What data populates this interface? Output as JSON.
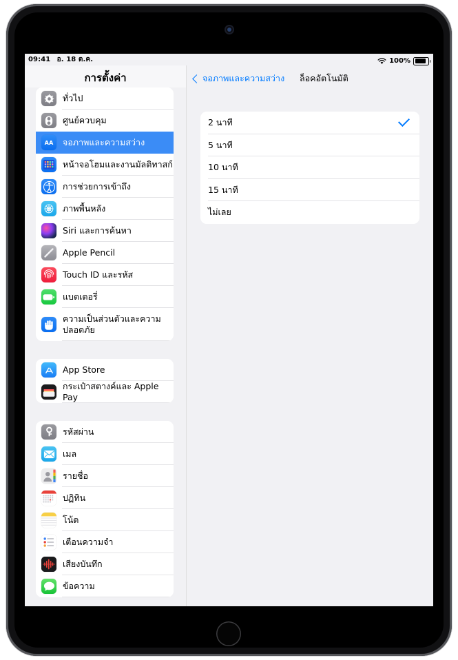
{
  "status_bar": {
    "time": "09:41",
    "date": "อ. 18 ต.ค.",
    "wifi_icon": "wifi-icon",
    "battery_percent": "100%",
    "battery_icon": "battery-full-icon"
  },
  "sidebar": {
    "title": "การตั้งค่า",
    "groups": [
      {
        "items": [
          {
            "label": "ทั่วไป",
            "icon": "gear-icon",
            "selected": false
          },
          {
            "label": "ศูนย์ควบคุม",
            "icon": "control-center-icon",
            "selected": false
          },
          {
            "label": "จอภาพและความสว่าง",
            "icon": "display-brightness-icon",
            "selected": true
          },
          {
            "label": "หน้าจอโฮมและงานมัลติทาสก์",
            "icon": "home-screen-multitasking-icon",
            "selected": false
          },
          {
            "label": "การช่วยการเข้าถึง",
            "icon": "accessibility-icon",
            "selected": false
          },
          {
            "label": "ภาพพื้นหลัง",
            "icon": "wallpaper-icon",
            "selected": false
          },
          {
            "label": "Siri และการค้นหา",
            "icon": "siri-icon",
            "selected": false
          },
          {
            "label": "Apple Pencil",
            "icon": "apple-pencil-icon",
            "selected": false
          },
          {
            "label": "Touch ID และรหัส",
            "icon": "touch-id-icon",
            "selected": false
          },
          {
            "label": "แบตเตอรี่",
            "icon": "battery-icon",
            "selected": false
          },
          {
            "label": "ความเป็นส่วนตัวและความปลอดภัย",
            "icon": "privacy-hand-icon",
            "selected": false
          }
        ]
      },
      {
        "items": [
          {
            "label": "App Store",
            "icon": "app-store-icon",
            "selected": false
          },
          {
            "label": "กระเป๋าสตางค์และ Apple Pay",
            "icon": "wallet-icon",
            "selected": false
          }
        ]
      },
      {
        "items": [
          {
            "label": "รหัสผ่าน",
            "icon": "passwords-key-icon",
            "selected": false
          },
          {
            "label": "เมล",
            "icon": "mail-icon",
            "selected": false
          },
          {
            "label": "รายชื่อ",
            "icon": "contacts-icon",
            "selected": false
          },
          {
            "label": "ปฏิทิน",
            "icon": "calendar-icon",
            "selected": false
          },
          {
            "label": "โน้ต",
            "icon": "notes-icon",
            "selected": false
          },
          {
            "label": "เตือนความจำ",
            "icon": "reminders-icon",
            "selected": false
          },
          {
            "label": "เสียงบันทึก",
            "icon": "voice-memos-icon",
            "selected": false
          },
          {
            "label": "ข้อความ",
            "icon": "messages-icon",
            "selected": false
          }
        ]
      }
    ]
  },
  "detail": {
    "back_label": "จอภาพและความสว่าง",
    "back_icon": "chevron-left-icon",
    "title": "ล็อคอัตโนมัติ",
    "options": [
      {
        "label": "2 นาที",
        "checked": true
      },
      {
        "label": "5 นาที",
        "checked": false
      },
      {
        "label": "10 นาที",
        "checked": false
      },
      {
        "label": "15 นาที",
        "checked": false
      },
      {
        "label": "ไม่เลย",
        "checked": false
      }
    ],
    "checkmark_icon": "checkmark-icon"
  },
  "colors": {
    "accent": "#007aff",
    "selected_row": "#3b8cf6",
    "screen_bg": "#f1f1f4",
    "card_bg": "#ffffff"
  },
  "hardware": {
    "camera_icon": "front-camera",
    "home_button_icon": "home-button"
  }
}
